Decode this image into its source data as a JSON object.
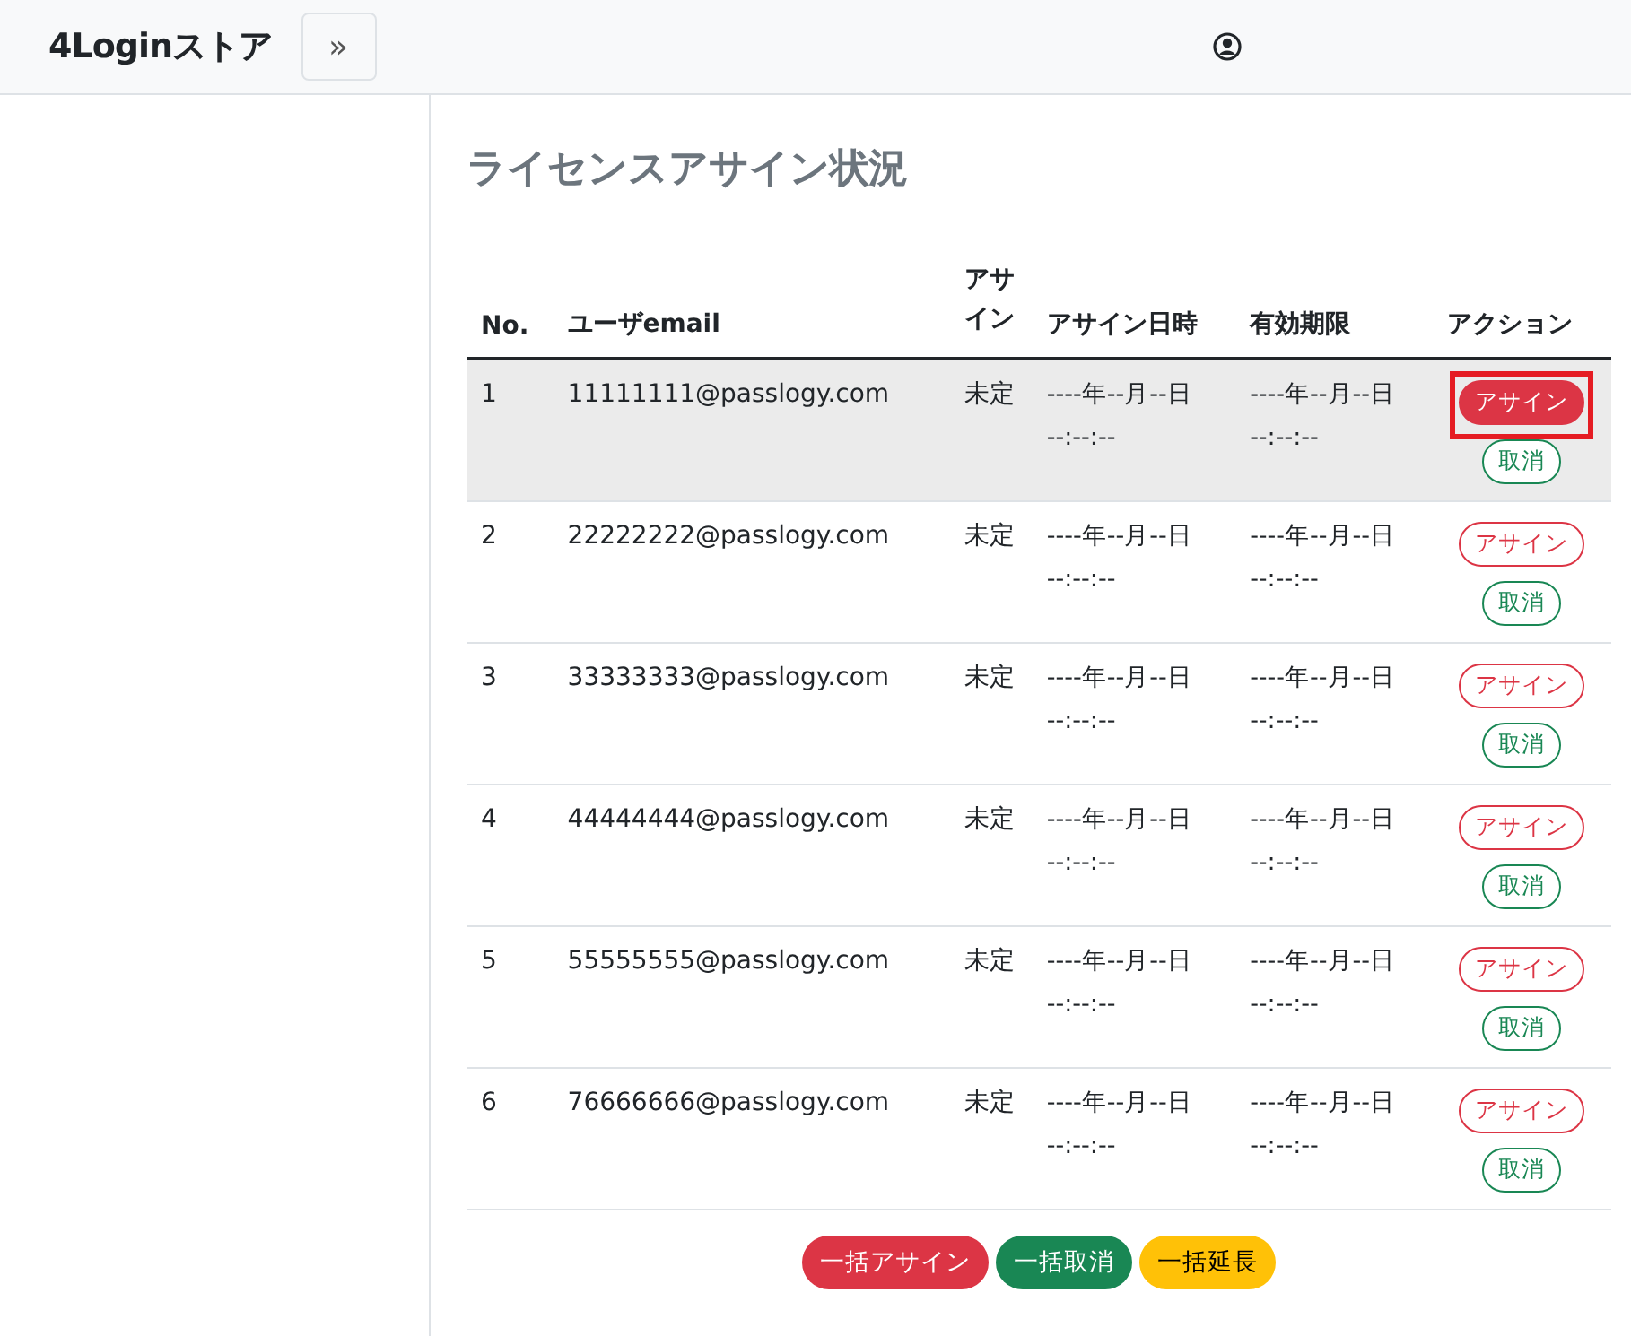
{
  "header": {
    "brand": "4Loginストア",
    "toggle_label": "»"
  },
  "page": {
    "title": "ライセンスアサイン状況"
  },
  "table": {
    "columns": [
      "No.",
      "ユーザemail",
      "アサイン",
      "アサイン日時",
      "有効期限",
      "アクション"
    ],
    "rows": [
      {
        "no": "1",
        "email": "11111111@passlogy.com",
        "status": "未定",
        "assigned_at": "----年--月--日\n--:--:--",
        "expires": "----年--月--日\n--:--:--",
        "assign_label": "アサイン",
        "cancel_label": "取消",
        "selected": true,
        "marked": true
      },
      {
        "no": "2",
        "email": "22222222@passlogy.com",
        "status": "未定",
        "assigned_at": "----年--月--日\n--:--:--",
        "expires": "----年--月--日\n--:--:--",
        "assign_label": "アサイン",
        "cancel_label": "取消",
        "selected": false,
        "marked": false
      },
      {
        "no": "3",
        "email": "33333333@passlogy.com",
        "status": "未定",
        "assigned_at": "----年--月--日\n--:--:--",
        "expires": "----年--月--日\n--:--:--",
        "assign_label": "アサイン",
        "cancel_label": "取消",
        "selected": false,
        "marked": false
      },
      {
        "no": "4",
        "email": "44444444@passlogy.com",
        "status": "未定",
        "assigned_at": "----年--月--日\n--:--:--",
        "expires": "----年--月--日\n--:--:--",
        "assign_label": "アサイン",
        "cancel_label": "取消",
        "selected": false,
        "marked": false
      },
      {
        "no": "5",
        "email": "55555555@passlogy.com",
        "status": "未定",
        "assigned_at": "----年--月--日\n--:--:--",
        "expires": "----年--月--日\n--:--:--",
        "assign_label": "アサイン",
        "cancel_label": "取消",
        "selected": false,
        "marked": false
      },
      {
        "no": "6",
        "email": "76666666@passlogy.com",
        "status": "未定",
        "assigned_at": "----年--月--日\n--:--:--",
        "expires": "----年--月--日\n--:--:--",
        "assign_label": "アサイン",
        "cancel_label": "取消",
        "selected": false,
        "marked": false
      }
    ]
  },
  "bulk_actions": [
    {
      "label": "一括アサイン",
      "kind": "danger"
    },
    {
      "label": "一括取消",
      "kind": "success"
    },
    {
      "label": "一括延長",
      "kind": "warning"
    }
  ]
}
